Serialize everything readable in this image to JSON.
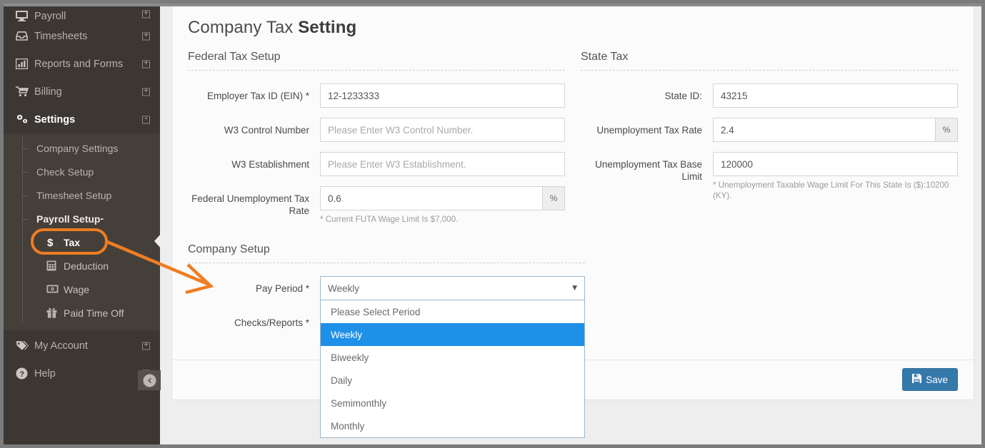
{
  "sidebar": {
    "items": [
      {
        "label": "Payroll",
        "icon": "desktop-icon",
        "expander": "+",
        "state": "cut-off"
      },
      {
        "label": "Timesheets",
        "icon": "inbox-icon",
        "expander": "+"
      },
      {
        "label": "Reports and Forms",
        "icon": "bar-chart-icon",
        "expander": "+"
      },
      {
        "label": "Billing",
        "icon": "cart-icon",
        "expander": "+"
      },
      {
        "label": "Settings",
        "icon": "gears-icon",
        "expander": "-",
        "active": true
      }
    ],
    "submenu": [
      {
        "label": "Company Settings"
      },
      {
        "label": "Check Setup"
      },
      {
        "label": "Timesheet Setup"
      },
      {
        "label": "Payroll Setup",
        "expander": "-",
        "active": true
      }
    ],
    "payroll_setup_children": [
      {
        "label": "Tax",
        "icon": "dollar-icon",
        "highlighted": true
      },
      {
        "label": "Deduction",
        "icon": "calculator-icon"
      },
      {
        "label": "Wage",
        "icon": "money-bill-icon"
      },
      {
        "label": "Paid Time Off",
        "icon": "gift-icon"
      }
    ],
    "bottom_items": [
      {
        "label": "My Account",
        "icon": "tags-icon",
        "expander": "+"
      },
      {
        "label": "Help",
        "icon": "question-circle-icon",
        "expander": "+"
      }
    ],
    "collapse_icon": "arrow-circle-left-icon"
  },
  "header": {
    "title_light": "Company Tax",
    "title_strong": "Setting"
  },
  "federal": {
    "section_title": "Federal Tax Setup",
    "fields": [
      {
        "label": "Employer Tax ID (EIN) *",
        "value": "12-1233333",
        "placeholder": ""
      },
      {
        "label": "W3 Control Number",
        "value": "",
        "placeholder": "Please Enter W3 Control Number."
      },
      {
        "label": "W3 Establishment",
        "value": "",
        "placeholder": "Please Enter W3 Establishment."
      },
      {
        "label": "Federal Unemployment Tax Rate",
        "value": "0.6",
        "placeholder": "",
        "addon": "%",
        "hint": "* Current FUTA Wage Limit Is $7,000."
      }
    ]
  },
  "state": {
    "section_title": "State Tax",
    "fields": [
      {
        "label": "State ID:",
        "value": "43215",
        "placeholder": ""
      },
      {
        "label": "Unemployment Tax Rate",
        "value": "2.4",
        "placeholder": "",
        "addon": "%"
      },
      {
        "label": "Unemployment Tax Base Limit",
        "value": "120000",
        "placeholder": "",
        "hint": "* Unemployment Taxable Wage Limit For This State Is ($):10200 (KY)."
      }
    ]
  },
  "company": {
    "section_title": "Company Setup",
    "pay_period_label": "Pay Period *",
    "pay_period_value": "Weekly",
    "pay_period_options": [
      "Please Select Period",
      "Weekly",
      "Biweekly",
      "Daily",
      "Semimonthly",
      "Monthly"
    ],
    "pay_period_selected_index": 1,
    "checks_reports_label": "Checks/Reports *",
    "caret_icon": "chevron-down-icon"
  },
  "footer": {
    "save_label": "Save",
    "save_icon": "floppy-disk-icon"
  },
  "annotation": {
    "highlight_target": "Tax",
    "arrow_from": "Tax",
    "arrow_to": "Pay Period *",
    "color": "#ef7d23"
  },
  "colors": {
    "sidebar_bg": "#3c3733",
    "submenu_bg": "#453f3a",
    "accent_blue": "#1e90e8",
    "save_blue": "#3579ab",
    "annotation_orange": "#ef7d23",
    "page_bg": "#efeeee"
  }
}
